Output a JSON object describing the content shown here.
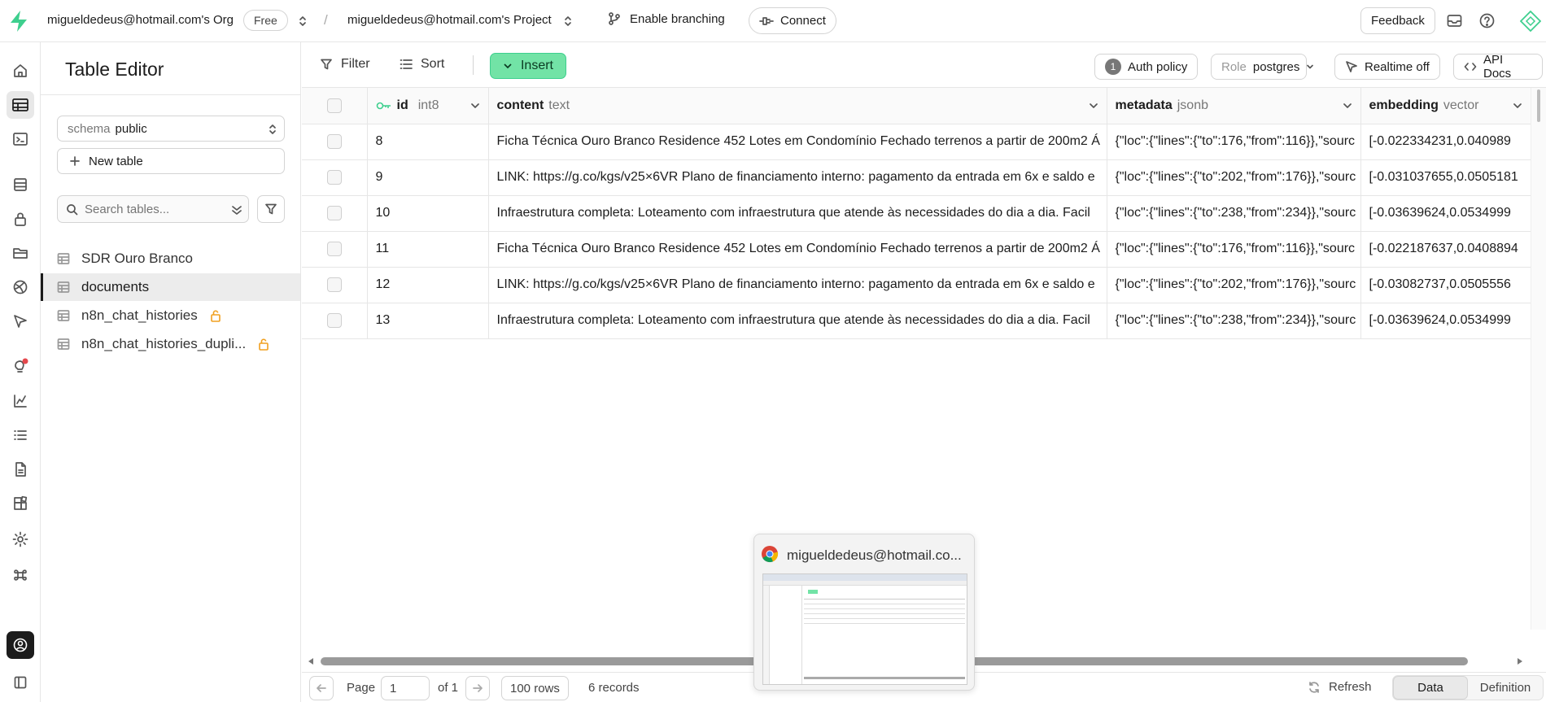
{
  "topbar": {
    "org_name": "migueldedeus@hotmail.com's Org",
    "plan_badge": "Free",
    "separator": "/",
    "project_name": "migueldedeus@hotmail.com's Project",
    "branching_label": "Enable branching",
    "connect_label": "Connect",
    "feedback_label": "Feedback"
  },
  "sidebar": {
    "title": "Table Editor",
    "schema_label": "schema",
    "schema_value": "public",
    "new_table_label": "New table",
    "search_placeholder": "Search tables...",
    "tables": [
      {
        "name": "SDR Ouro Branco",
        "locked": false
      },
      {
        "name": "documents",
        "locked": false
      },
      {
        "name": "n8n_chat_histories",
        "locked": true
      },
      {
        "name": "n8n_chat_histories_dupli...",
        "locked": true
      }
    ]
  },
  "toolbar": {
    "filter_label": "Filter",
    "sort_label": "Sort",
    "insert_label": "Insert",
    "auth_count": "1",
    "auth_label": "Auth policy",
    "role_label": "Role",
    "role_value": "postgres",
    "realtime_label": "Realtime off",
    "api_docs_label": "API Docs"
  },
  "table": {
    "columns": [
      {
        "name": "id",
        "type": "int8"
      },
      {
        "name": "content",
        "type": "text"
      },
      {
        "name": "metadata",
        "type": "jsonb"
      },
      {
        "name": "embedding",
        "type": "vector"
      }
    ],
    "rows": [
      {
        "id": "8",
        "content": "Ficha Técnica Ouro Branco Residence 452 Lotes em Condomínio Fechado terrenos a partir de 200m2 Á",
        "metadata": "{\"loc\":{\"lines\":{\"to\":176,\"from\":116}},\"sourc",
        "embedding": "[-0.022334231,0.040989"
      },
      {
        "id": "9",
        "content": "LINK: https://g.co/kgs/v25×6VR Plano de financiamento interno: pagamento da entrada em 6x e saldo e",
        "metadata": "{\"loc\":{\"lines\":{\"to\":202,\"from\":176}},\"sourc",
        "embedding": "[-0.031037655,0.0505181"
      },
      {
        "id": "10",
        "content": "Infraestrutura completa: Loteamento com infraestrutura que atende às necessidades do dia a dia. Facil",
        "metadata": "{\"loc\":{\"lines\":{\"to\":238,\"from\":234}},\"sourc",
        "embedding": "[-0.03639624,0.0534999"
      },
      {
        "id": "11",
        "content": "Ficha Técnica Ouro Branco Residence 452 Lotes em Condomínio Fechado terrenos a partir de 200m2 Á",
        "metadata": "{\"loc\":{\"lines\":{\"to\":176,\"from\":116}},\"sourc",
        "embedding": "[-0.022187637,0.0408894"
      },
      {
        "id": "12",
        "content": "LINK: https://g.co/kgs/v25×6VR Plano de financiamento interno: pagamento da entrada em 6x e saldo e",
        "metadata": "{\"loc\":{\"lines\":{\"to\":202,\"from\":176}},\"sourc",
        "embedding": "[-0.03082737,0.0505556"
      },
      {
        "id": "13",
        "content": "Infraestrutura completa: Loteamento com infraestrutura que atende às necessidades do dia a dia. Facil",
        "metadata": "{\"loc\":{\"lines\":{\"to\":238,\"from\":234}},\"sourc",
        "embedding": "[-0.03639624,0.0534999"
      }
    ]
  },
  "footer": {
    "page_label": "Page",
    "page_value": "1",
    "of_label": "of 1",
    "rows_label": "100 rows",
    "records_label": "6 records",
    "refresh_label": "Refresh",
    "data_tab": "Data",
    "definition_tab": "Definition"
  },
  "preview": {
    "title": "migueldedeus@hotmail.co..."
  },
  "colors": {
    "accent": "#3ecf8e",
    "insert_bg": "#72e3a6",
    "lock": "#f0a020"
  }
}
